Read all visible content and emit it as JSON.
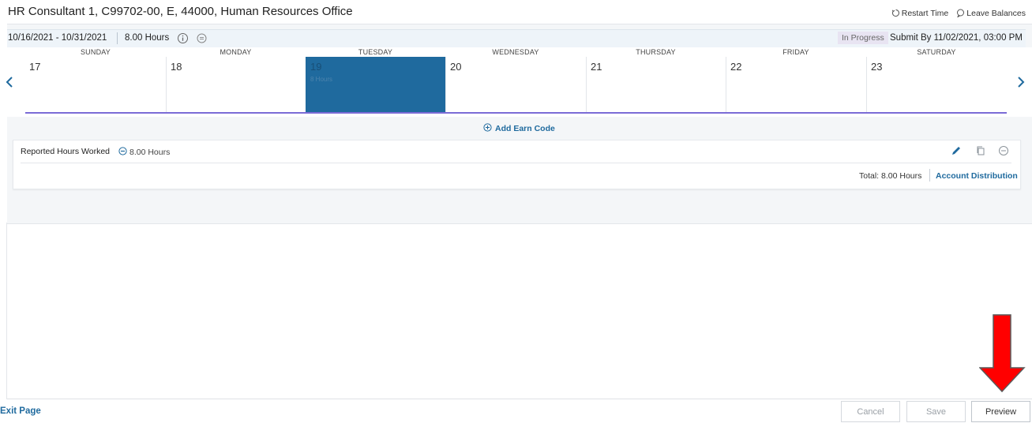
{
  "header": {
    "title": "HR Consultant 1, C99702-00, E, 44000, Human Resources Office",
    "restart_time": "Restart Time",
    "leave_balances": "Leave Balances"
  },
  "period": {
    "range": "10/16/2021 - 10/31/2021",
    "hours": "8.00 Hours",
    "status": "In Progress",
    "submit_by": "Submit By 11/02/2021, 03:00 PM"
  },
  "calendar": {
    "days": [
      {
        "name": "SUNDAY",
        "date": "17"
      },
      {
        "name": "MONDAY",
        "date": "18"
      },
      {
        "name": "TUESDAY",
        "date": "19",
        "sub": "8 Hours",
        "selected": true
      },
      {
        "name": "WEDNESDAY",
        "date": "20"
      },
      {
        "name": "THURSDAY",
        "date": "21"
      },
      {
        "name": "FRIDAY",
        "date": "22"
      },
      {
        "name": "SATURDAY",
        "date": "23"
      }
    ]
  },
  "earn": {
    "add_label": "Add Earn Code",
    "row_label": "Reported Hours Worked",
    "row_hours": "8.00 Hours",
    "total": "Total: 8.00 Hours",
    "account_distribution": "Account Distribution"
  },
  "footer": {
    "exit": "Exit Page",
    "cancel": "Cancel",
    "save": "Save",
    "preview": "Preview"
  },
  "colors": {
    "accent": "#1f6a9e",
    "selected_day": "#1f6a9e",
    "underline": "#7b6bd6",
    "annotation_arrow": "#ff0000"
  }
}
